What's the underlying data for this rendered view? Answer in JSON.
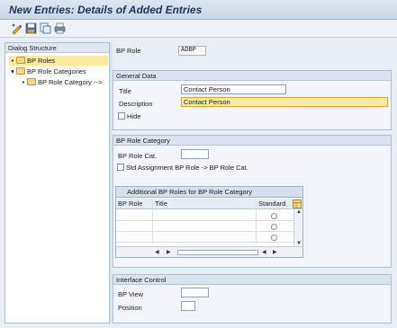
{
  "window": {
    "title": "New Entries: Details of Added Entries"
  },
  "toolbar": {
    "icons": [
      "display-change-icon",
      "save-icon",
      "copy-icon",
      "print-icon"
    ]
  },
  "dialog_structure": {
    "header": "Dialog Structure",
    "items": [
      {
        "label": "BP Roles",
        "selected": true
      },
      {
        "label": "BP Role Categories",
        "selected": false
      },
      {
        "label": "BP Role Category -->",
        "selected": false
      }
    ]
  },
  "bp_role": {
    "label": "BP Role",
    "value": "ADBP"
  },
  "general_data": {
    "header": "General Data",
    "title_label": "Title",
    "title_value": "Contact Person",
    "description_label": "Description",
    "description_value": "Contact Person",
    "hide_label": "Hide"
  },
  "role_category": {
    "header": "BP Role Category",
    "cat_label": "BP Role Cat.",
    "cat_value": "",
    "std_label": "Std Assignment BP Role -> BP Role Cat."
  },
  "additional_table": {
    "caption": "Additional BP Roles for BP Role Category",
    "columns": [
      "BP Role",
      "Title",
      "Standard"
    ],
    "rows": [
      {
        "bp_role": "",
        "title": "",
        "standard": false
      },
      {
        "bp_role": "",
        "title": "",
        "standard": false
      },
      {
        "bp_role": "",
        "title": "",
        "standard": false
      }
    ]
  },
  "interface_control": {
    "header": "Interface Control",
    "bp_view_label": "BP View",
    "bp_view_value": "",
    "position_label": "Position",
    "position_value": ""
  }
}
